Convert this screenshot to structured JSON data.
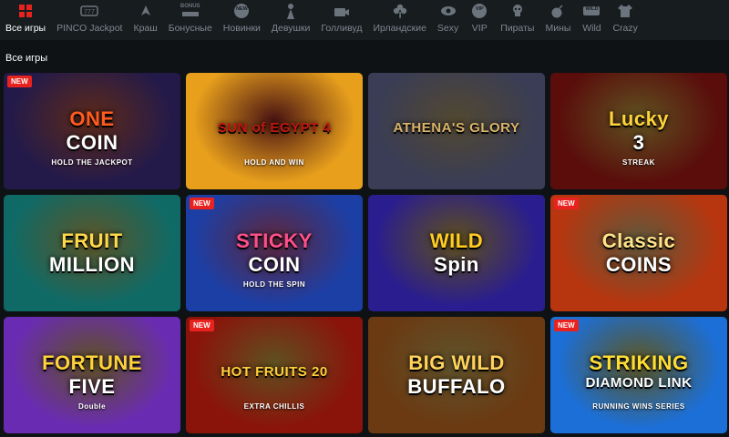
{
  "nav": {
    "items": [
      {
        "label": "Все игры",
        "icon": "grid-icon",
        "active": true
      },
      {
        "label": "PINCO Jackpot",
        "icon": "jackpot-icon"
      },
      {
        "label": "Краш",
        "icon": "rocket-icon"
      },
      {
        "label": "Бонусные",
        "icon": "bonus-icon",
        "icon_text": "BONUS"
      },
      {
        "label": "Новинки",
        "icon": "new-icon",
        "icon_text": "NEW"
      },
      {
        "label": "Девушки",
        "icon": "girl-icon"
      },
      {
        "label": "Голливуд",
        "icon": "camera-icon"
      },
      {
        "label": "Ирландские",
        "icon": "clover-icon"
      },
      {
        "label": "Sexy",
        "icon": "eye-icon"
      },
      {
        "label": "VIP",
        "icon": "vip-icon",
        "icon_text": "VIP"
      },
      {
        "label": "Пираты",
        "icon": "skull-icon"
      },
      {
        "label": "Мины",
        "icon": "bomb-icon"
      },
      {
        "label": "Wild",
        "icon": "wild-icon",
        "icon_text": "WILD"
      },
      {
        "label": "Crazy",
        "icon": "shirt-icon"
      }
    ]
  },
  "section": {
    "title": "Все игры"
  },
  "badge_label": "NEW",
  "games": [
    {
      "title_line1": "ONE",
      "title_line2": "COIN",
      "subtitle": "HOLD THE JACKPOT",
      "bg": "#231a4a",
      "accent": "#ff5a1f",
      "new": true
    },
    {
      "title_line1": "SUN of EGYPT 4",
      "title_line2": "",
      "subtitle": "HOLD AND WIN",
      "bg": "#e8a01c",
      "accent": "#c0160f",
      "new": false
    },
    {
      "title_line1": "ATHENA'S GLORY",
      "title_line2": "",
      "subtitle": "",
      "bg": "#3a3d55",
      "accent": "#d9b36a",
      "new": false
    },
    {
      "title_line1": "Lucky",
      "title_line2": "3",
      "subtitle": "STREAK",
      "bg": "#5a0d0b",
      "accent": "#ffd23a",
      "new": false
    },
    {
      "title_line1": "FRUIT",
      "title_line2": "MILLION",
      "subtitle": "",
      "bg": "#0f6a66",
      "accent": "#ffd84a",
      "new": false
    },
    {
      "title_line1": "STICKY",
      "title_line2": "COIN",
      "subtitle": "HOLD THE SPIN",
      "bg": "#1c3fa6",
      "accent": "#ff4f8a",
      "new": true
    },
    {
      "title_line1": "WILD",
      "title_line2": "Spin",
      "subtitle": "",
      "bg": "#2a1d8f",
      "accent": "#ffcc22",
      "new": false
    },
    {
      "title_line1": "Classic",
      "title_line2": "COINS",
      "subtitle": "",
      "bg": "#b8360f",
      "accent": "#ffe48a",
      "new": true
    },
    {
      "title_line1": "FORTUNE",
      "title_line2": "FIVE",
      "subtitle": "Double",
      "bg": "#6a2bb3",
      "accent": "#ffd23a",
      "new": false
    },
    {
      "title_line1": "HOT FRUITS 20",
      "title_line2": "",
      "subtitle": "EXTRA CHILLIS",
      "bg": "#8a140a",
      "accent": "#ffcf3a",
      "new": true
    },
    {
      "title_line1": "BIG WILD",
      "title_line2": "BUFFALO",
      "subtitle": "",
      "bg": "#6b3a12",
      "accent": "#ffd25a",
      "new": false
    },
    {
      "title_line1": "STRIKING",
      "title_line2": "DIAMOND LINK",
      "subtitle": "RUNNING WINS SERIES",
      "bg": "#1c6fd6",
      "accent": "#ffdd33",
      "new": true
    }
  ]
}
